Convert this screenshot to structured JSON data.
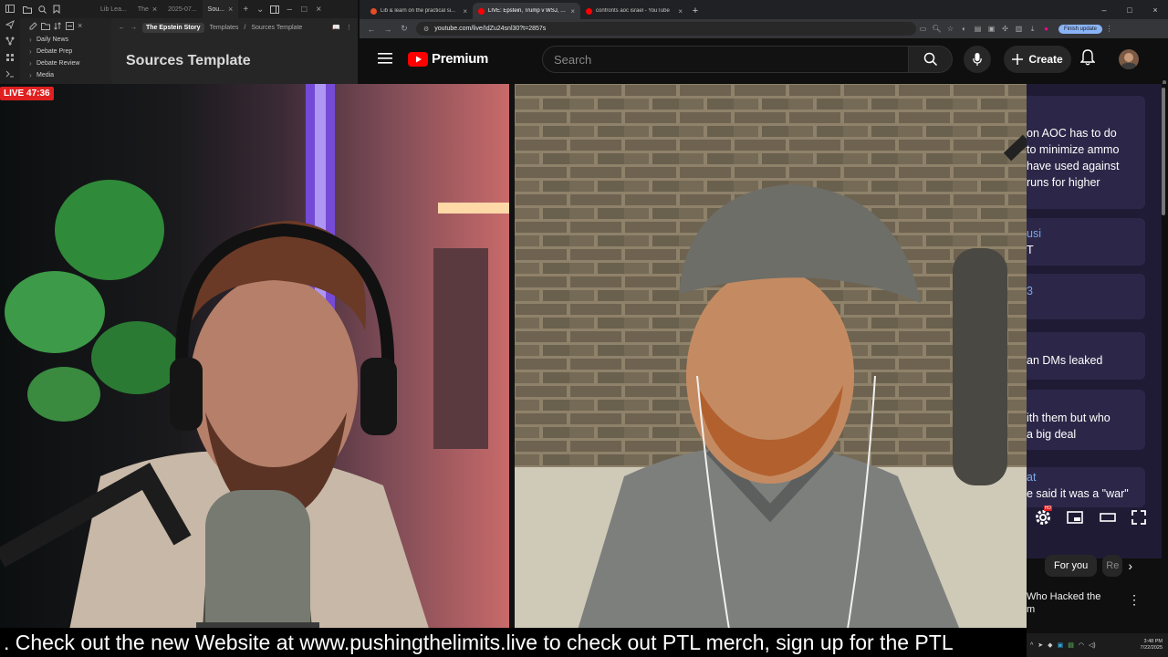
{
  "notes_app": {
    "tabs": [
      {
        "label": "Lib Lea...",
        "active": false
      },
      {
        "label": "The",
        "active": false
      },
      {
        "label": "2025-07...",
        "active": false
      },
      {
        "label": "Sou...",
        "active": true
      }
    ],
    "tree": [
      "Daily News",
      "Debate Prep",
      "Debate Review",
      "Media"
    ],
    "breadcrumb": [
      "The Epstein Story",
      "Templates",
      "Sources Template"
    ],
    "note_title": "Sources Template"
  },
  "browser": {
    "tabs": [
      {
        "label": "Lib & learn on the practical si...",
        "favicon_color": "#e44d26",
        "active": false
      },
      {
        "label": "LIVE: Epstein, Trump v WSJ, Cli...",
        "favicon_color": "#ff0000",
        "active": true
      },
      {
        "label": "confronts aoc israel - YouTube",
        "favicon_color": "#ff0000",
        "active": false
      }
    ],
    "url": "youtube.com/live/IdZu24snl30?t=2857s",
    "finish_update": "Finish update"
  },
  "youtube": {
    "logo_text": "Premium",
    "search_placeholder": "Search",
    "create_label": "Create",
    "brand_red": "#ff0000"
  },
  "video": {
    "live_badge": "LIVE 47:36",
    "ticker_text": ". Check out the new Website at www.pushingthelimits.live to check out PTL merch, sign up for the PTL"
  },
  "chat": {
    "messages": [
      {
        "author": "",
        "lines": [
          "on AOC has to do",
          "to minimize ammo",
          "have used against",
          "runs for higher"
        ]
      },
      {
        "author": "usi",
        "lines": [
          "T"
        ]
      },
      {
        "author": "3",
        "lines": []
      },
      {
        "author": "",
        "lines": [
          "an DMs leaked"
        ]
      },
      {
        "author": "",
        "lines": [
          "ith them but who",
          "a big deal"
        ]
      },
      {
        "author": "at",
        "lines": [
          "e said it was a \"war\""
        ]
      }
    ]
  },
  "player": {
    "settings_badge": "HD"
  },
  "chips": {
    "for_you": "For you",
    "partial": "Re"
  },
  "recommendation": {
    "title": "Who Hacked the",
    "title_line2": "m"
  },
  "taskbar": {
    "time": "3:48 PM",
    "date": "7/22/2025"
  }
}
